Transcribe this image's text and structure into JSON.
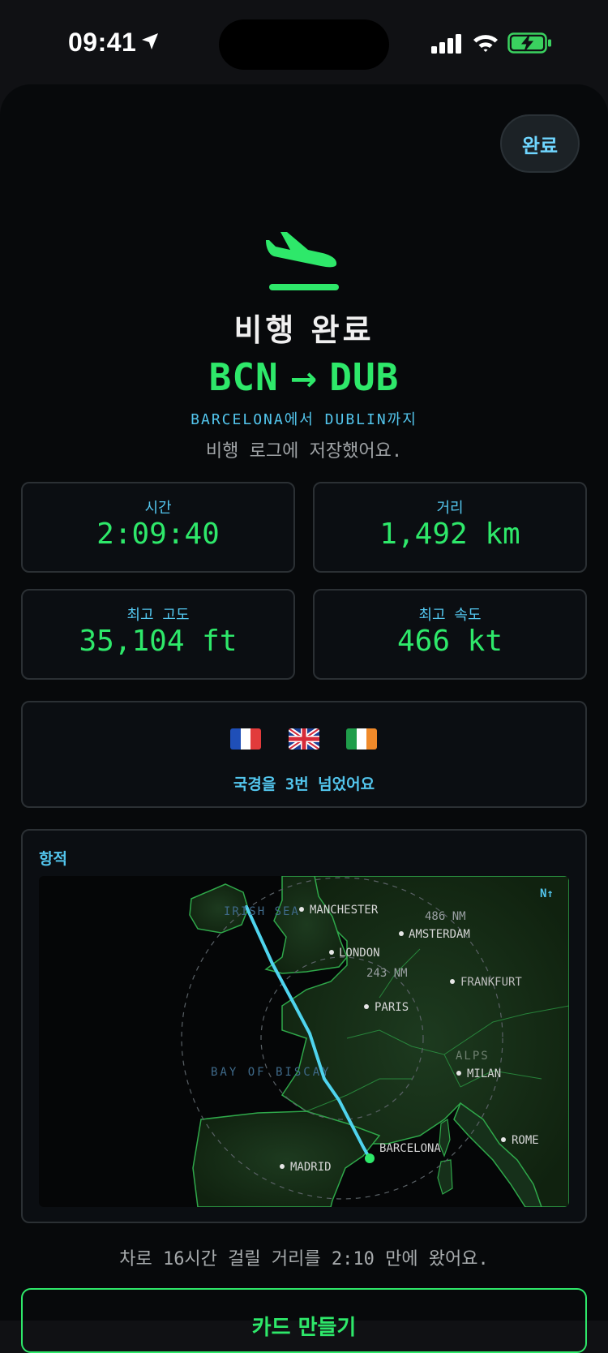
{
  "status_bar": {
    "time": "09:41"
  },
  "header": {
    "done_label": "완료"
  },
  "summary": {
    "title": "비행 완료",
    "from": "BCN",
    "to": "DUB",
    "route_text": "BARCELONA에서 DUBLIN까지",
    "saved_text": "비행 로그에 저장했어요."
  },
  "stats": [
    {
      "label": "시간",
      "value": "2:09:40"
    },
    {
      "label": "거리",
      "value": "1,492 km"
    },
    {
      "label": "최고 고도",
      "value": "35,104 ft"
    },
    {
      "label": "최고 속도",
      "value": "466 kt"
    }
  ],
  "borders": {
    "flags": [
      "France",
      "United Kingdom",
      "Ireland"
    ],
    "text": "국경을 3번 넘었어요"
  },
  "track": {
    "label": "항적",
    "compass": "N↑",
    "cities": [
      "MANCHESTER",
      "AMSTERDAM",
      "LONDON",
      "FRANKFURT",
      "PARIS",
      "MILAN",
      "ROME",
      "BARCELONA",
      "MADRID"
    ],
    "seas": [
      "IRISH SEA",
      "BAY OF BISCAY",
      "ALPS"
    ],
    "rings": [
      "486 NM",
      "243 NM"
    ]
  },
  "footer": {
    "note": "차로 16시간 걸릴 거리를 2:10 만에 왔어요.",
    "card_button": "카드 만들기"
  },
  "colors": {
    "accent_green": "#2ee86a",
    "accent_blue": "#53c6ee",
    "background": "#07090b"
  }
}
